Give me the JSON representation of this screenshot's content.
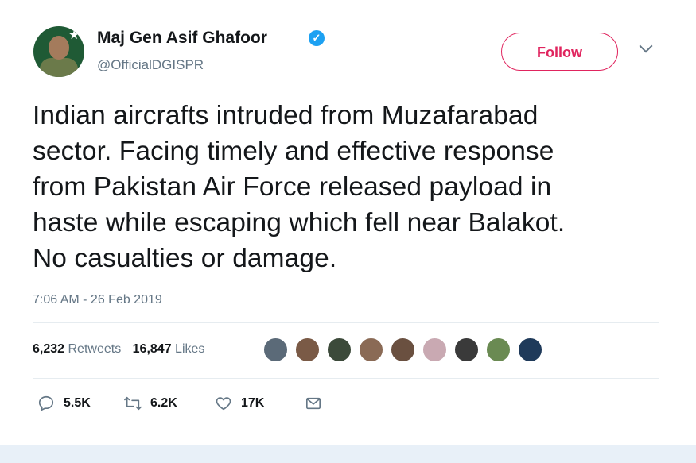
{
  "author": {
    "name": "Maj Gen Asif Ghafoor",
    "handle": "@OfficialDGISPR",
    "verified": true
  },
  "follow_button": {
    "label": "Follow"
  },
  "menu_icon": "chevron-down-icon",
  "tweet": {
    "text": "Indian aircrafts intruded from Muzafarabad\nsector. Facing timely and effective response\nfrom Pakistan Air Force released payload in\nhaste while escaping which fell near Balakot.\nNo casualties or damage.",
    "timestamp": "7:06 AM - 26 Feb 2019"
  },
  "stats": {
    "retweets_count": "6,232",
    "retweets_label": "Retweets",
    "likes_count": "16,847",
    "likes_label": "Likes"
  },
  "likers_avatars": [
    "#5b6a78",
    "#7a5a46",
    "#3c4a3a",
    "#8a6a55",
    "#6a5040",
    "#c9a9b2",
    "#3a3a3a",
    "#6a8a52",
    "#1f3a5a"
  ],
  "actions": {
    "replies": "5.5K",
    "retweets": "6.2K",
    "likes": "17K"
  },
  "colors": {
    "follow_accent": "#e0245e",
    "verified_blue": "#1da1f2",
    "secondary_text": "#657786"
  }
}
